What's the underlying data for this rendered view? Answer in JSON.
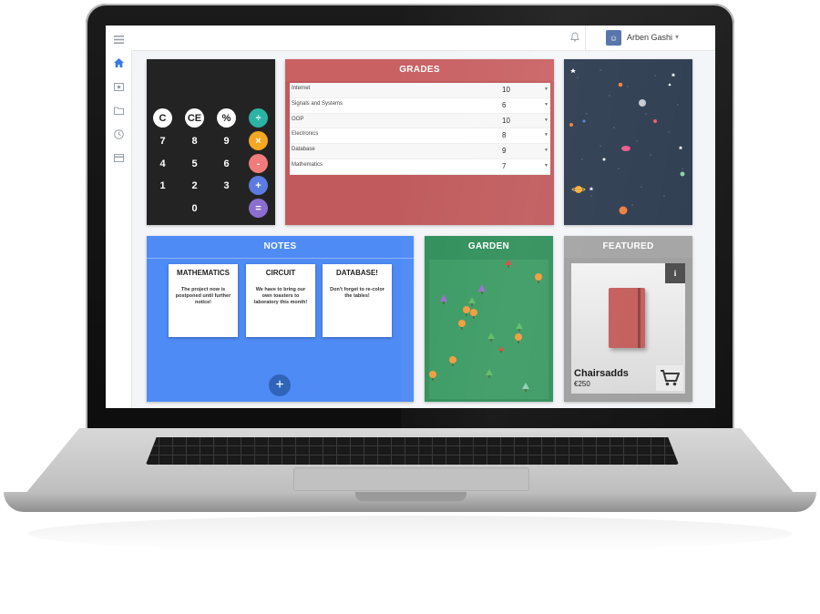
{
  "header": {
    "user_name": "Arben Gashi",
    "user_initial": "☺"
  },
  "sidebar": {
    "items": [
      {
        "icon": "menu-icon"
      },
      {
        "icon": "home-icon"
      },
      {
        "icon": "money-icon"
      },
      {
        "icon": "folder-icon"
      },
      {
        "icon": "clock-icon"
      },
      {
        "icon": "card-icon"
      }
    ]
  },
  "calculator": {
    "keys": [
      "C",
      "CE",
      "%",
      "÷",
      "7",
      "8",
      "9",
      "×",
      "4",
      "5",
      "6",
      "-",
      "1",
      "2",
      "3",
      "+",
      "0",
      "="
    ],
    "colors": {
      "divide": "#2bb3a3",
      "multiply": "#f5a623",
      "minus": "#f07c7c",
      "plus": "#5b7be0",
      "equals": "#8a6fd1"
    }
  },
  "grades": {
    "title": "GRADES",
    "rows": [
      {
        "subject": "Internet",
        "value": "10"
      },
      {
        "subject": "Signals and Systems",
        "value": "6"
      },
      {
        "subject": "OOP",
        "value": "10"
      },
      {
        "subject": "Electronics",
        "value": "8"
      },
      {
        "subject": "Database",
        "value": "9"
      },
      {
        "subject": "Mathematics",
        "value": "7"
      }
    ]
  },
  "notes": {
    "title": "NOTES",
    "items": [
      {
        "title": "MATHEMATICS",
        "body": "The project now is postponed until further notice!"
      },
      {
        "title": "CIRCUIT",
        "body": "We have to bring our own toasters to laboratory this month!"
      },
      {
        "title": "DATABASE!",
        "body": "Don't forget to re-color the tables!"
      }
    ],
    "add_label": "+"
  },
  "garden": {
    "title": "GARDEN"
  },
  "featured": {
    "title": "FEATURED",
    "info_label": "i",
    "product_name": "Chairsadds",
    "product_price": "€250"
  }
}
